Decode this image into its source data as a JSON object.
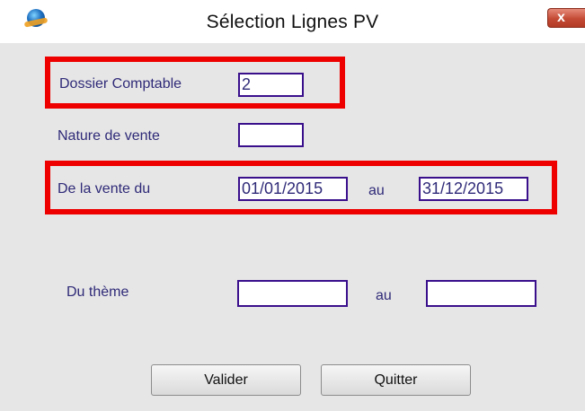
{
  "window": {
    "title": "Sélection Lignes PV",
    "app_icon": "globe-icon",
    "close_icon": "close-icon",
    "close_glyph": "x"
  },
  "form": {
    "dossier_comptable": {
      "label": "Dossier Comptable",
      "value": "2"
    },
    "nature_de_vente": {
      "label": "Nature de vente",
      "value": ""
    },
    "vente": {
      "label": "De la vente du",
      "from": "01/01/2015",
      "to_label": "au",
      "to": "31/12/2015"
    },
    "theme": {
      "label": "Du thème",
      "from": "",
      "to_label": "au",
      "to": ""
    }
  },
  "buttons": {
    "validate": "Valider",
    "quit": "Quitter"
  },
  "colors": {
    "highlight": "#ee0000",
    "field_border": "#3a0f8c",
    "label": "#2f2a78",
    "background": "#e6e6e6"
  }
}
